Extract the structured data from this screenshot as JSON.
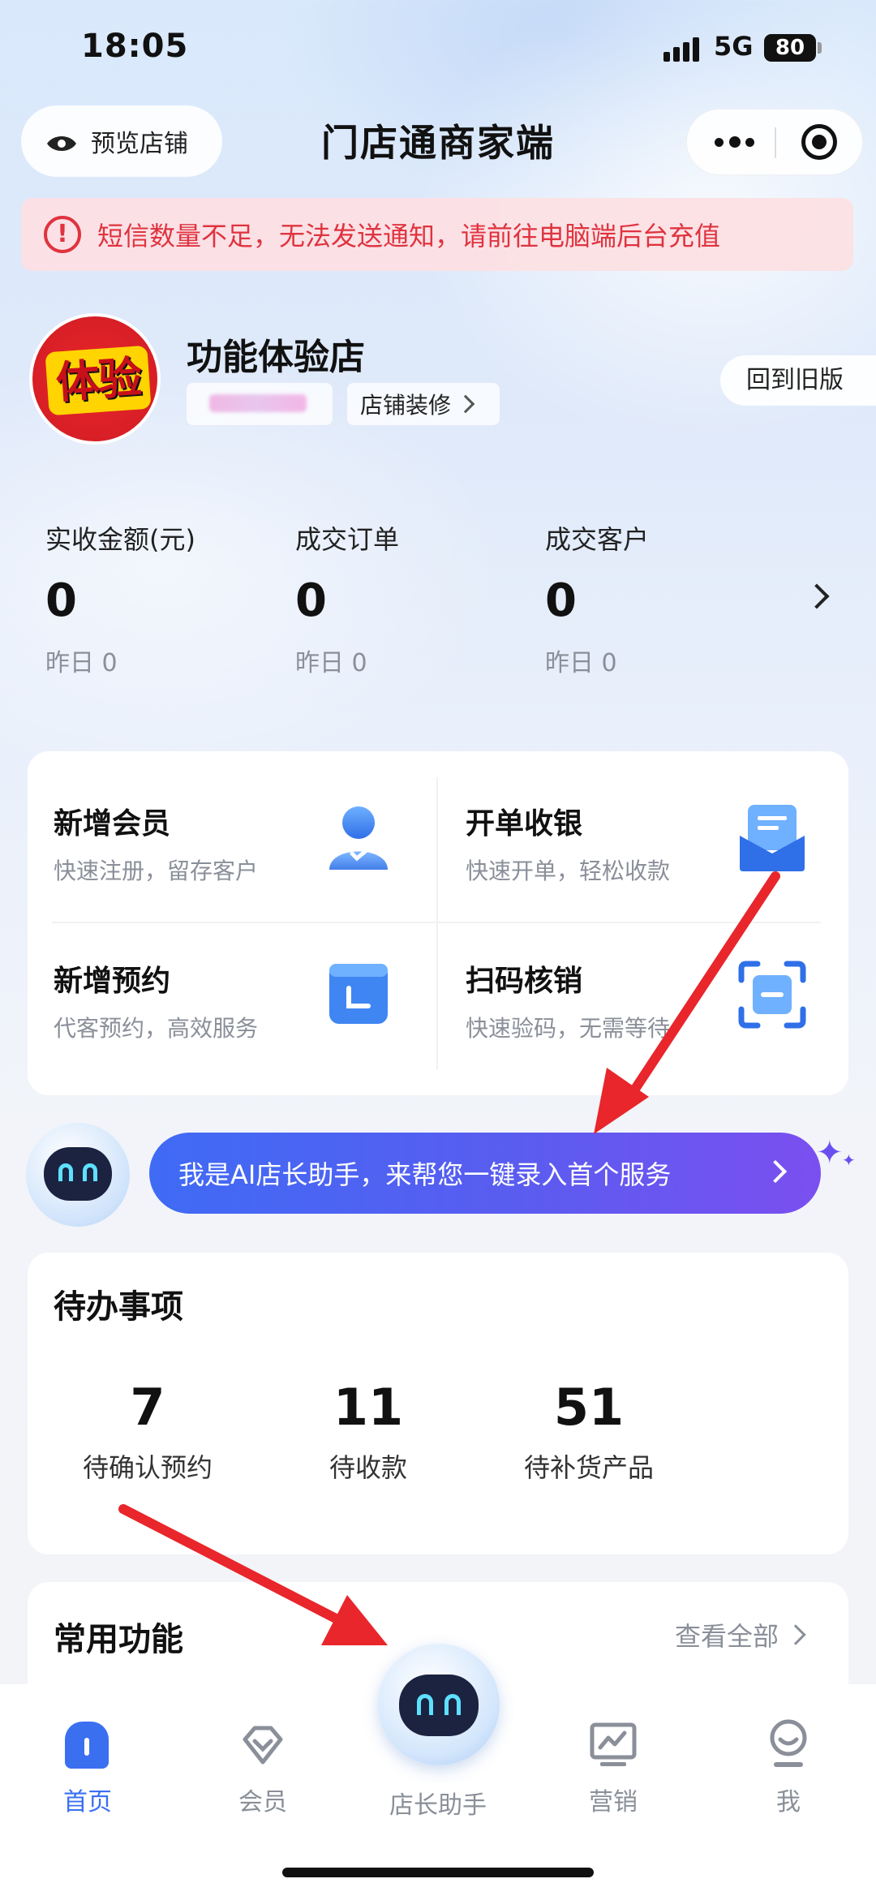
{
  "status_bar": {
    "time": "18:05",
    "network": "5G",
    "battery": "80"
  },
  "header": {
    "preview_label": "预览店铺",
    "title": "门店通商家端"
  },
  "alert": {
    "icon_text": "!",
    "text": "短信数量不足，无法发送通知，请前往电脑端后台充值"
  },
  "store": {
    "logo_text": "体验",
    "name": "功能体验店",
    "decorate_label": "店铺装修",
    "old_version_label": "回到旧版"
  },
  "stats": [
    {
      "label": "实收金额(元)",
      "value": "0",
      "yesterday": "昨日 0"
    },
    {
      "label": "成交订单",
      "value": "0",
      "yesterday": "昨日 0"
    },
    {
      "label": "成交客户",
      "value": "0",
      "yesterday": "昨日 0"
    }
  ],
  "quick_actions": [
    {
      "title": "新增会员",
      "subtitle": "快速注册，留存客户",
      "icon": "member-icon"
    },
    {
      "title": "开单收银",
      "subtitle": "快速开单，轻松收款",
      "icon": "cashier-icon"
    },
    {
      "title": "新增预约",
      "subtitle": "代客预约，高效服务",
      "icon": "calendar-icon"
    },
    {
      "title": "扫码核销",
      "subtitle": "快速验码，无需等待",
      "icon": "scan-icon"
    }
  ],
  "ai_banner": {
    "text": "我是AI店长助手，来帮您一键录入首个服务"
  },
  "todo": {
    "title": "待办事项",
    "items": [
      {
        "value": "7",
        "label": "待确认预约"
      },
      {
        "value": "11",
        "label": "待收款"
      },
      {
        "value": "51",
        "label": "待补货产品"
      }
    ]
  },
  "common": {
    "title": "常用功能",
    "view_all": "查看全部"
  },
  "tabbar": {
    "items": [
      {
        "label": "首页",
        "icon": "home-icon",
        "active": true
      },
      {
        "label": "会员",
        "icon": "member-tab-icon",
        "active": false
      },
      {
        "label": "店长助手",
        "icon": "robot-icon",
        "active": false
      },
      {
        "label": "营销",
        "icon": "marketing-icon",
        "active": false
      },
      {
        "label": "我",
        "icon": "profile-icon",
        "active": false
      }
    ]
  },
  "colors": {
    "accent": "#3a6ff0",
    "alert": "#e0333f",
    "banner_start": "#3f6bf5",
    "banner_end": "#7b4ff0",
    "annotation": "#e8262b"
  }
}
